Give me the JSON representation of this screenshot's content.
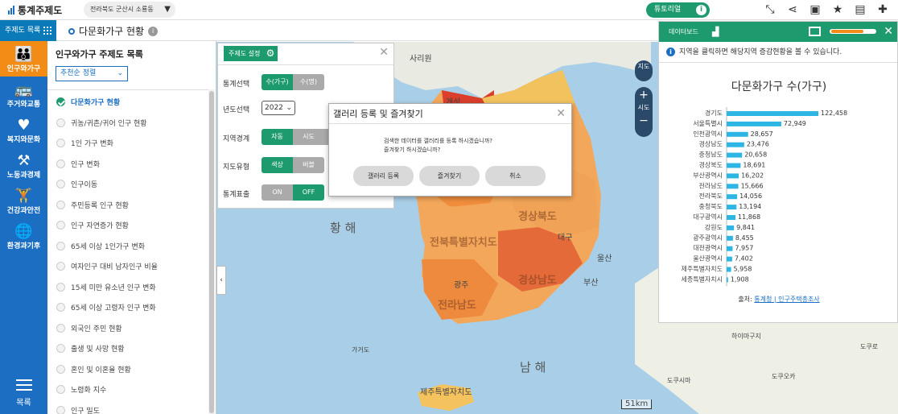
{
  "header": {
    "brand": "통계주제도",
    "region": "전라북도 군산시 소룡동",
    "tutorial": "튜토리얼"
  },
  "subbar": {
    "menu_toggle": "주제도 목록",
    "page_title": "다문화가구 현황"
  },
  "nav": {
    "items": [
      {
        "label": "인구와가구",
        "icon": "family-icon"
      },
      {
        "label": "주거와교통",
        "icon": "bus-icon"
      },
      {
        "label": "복지와문화",
        "icon": "heart-icon"
      },
      {
        "label": "노동과경제",
        "icon": "worker-icon"
      },
      {
        "label": "건강과안전",
        "icon": "exercise-icon"
      },
      {
        "label": "환경과기후",
        "icon": "globe-icon"
      }
    ],
    "bottom_label": "목록"
  },
  "theme_panel": {
    "title": "인구와가구 주제도 목록",
    "sort": "추천순 정렬",
    "items": [
      "다문화가구 현황",
      "귀농/귀촌/귀어 인구 현황",
      "1인 가구 변화",
      "인구 변화",
      "인구이동",
      "주민등록 인구 현황",
      "인구 자연증가 현황",
      "65세 이상 1인가구 변화",
      "여자인구 대비 남자인구 비율",
      "15세 미만 유소년 인구 변화",
      "65세 이상 고령자 인구 변화",
      "외국인 주민 현황",
      "출생 및 사망 현황",
      "혼인 및 이혼율 현황",
      "노령화 지수",
      "인구 밀도"
    ]
  },
  "settings": {
    "button": "주제도 설정",
    "rows": [
      {
        "label": "통계선택",
        "options": [
          "수(가구)",
          "수(명)"
        ],
        "active": 0
      },
      {
        "label": "년도선택",
        "year": "2022"
      },
      {
        "label": "지역경계",
        "options": [
          "자동",
          "시도",
          ""
        ],
        "active": 0
      },
      {
        "label": "지도유형",
        "options": [
          "색상",
          "버블"
        ],
        "active": 0
      },
      {
        "label": "통계표출",
        "options": [
          "ON",
          "OFF"
        ],
        "active": 1
      }
    ]
  },
  "modal": {
    "title": "갤러리 등록 및 즐겨찾기",
    "line1": "검색한 데이터를 갤러리를 등록 하시겠습니까?",
    "line2": "즐겨찾기 하시겠습니까?",
    "buttons": [
      "갤러리 등록",
      "즐겨찾기",
      "취소"
    ]
  },
  "map": {
    "labels": {
      "yellow_sea": "황 해",
      "south_sea": "남 해",
      "sariwon": "사리원",
      "kaesong": "개성",
      "ulsan": "울산",
      "busan": "부산",
      "gageodo": "가거도",
      "jeonbuk": "전북특별자치도",
      "jeonnam": "전라남도",
      "gyeongbuk": "경상북도",
      "gyeongnam": "경상남도",
      "daegu": "대구",
      "jeju": "제주특별자치도",
      "kyushu_a": "하이마구지",
      "kyushu_b": "도쿠시마",
      "kyushu_c": "도쿠오카",
      "kyushu_d": "도쿠로",
      "gwangju": "광주"
    },
    "scale": "51km",
    "ctrl_map": "지도",
    "ctrl_sido": "시도"
  },
  "dashboard": {
    "title": "데이터보드",
    "notice": "지역을 클릭하면 해당지역 증감현황을 볼 수 있습니다.",
    "source_prefix": "출처:",
    "source_link": "통계청 | 인구주택총조사"
  },
  "chart_data": {
    "type": "bar",
    "title": "다문화가구 수(가구)",
    "orientation": "horizontal",
    "bar_color": "#2db6e3",
    "categories": [
      "경기도",
      "서울특별시",
      "인천광역시",
      "경상남도",
      "충청남도",
      "경상북도",
      "부산광역시",
      "전라남도",
      "전라북도",
      "충청북도",
      "대구광역시",
      "강원도",
      "광주광역시",
      "대전광역시",
      "울산광역시",
      "제주특별자치도",
      "세종특별자치시"
    ],
    "values": [
      122458,
      72949,
      28657,
      23476,
      20658,
      18691,
      16202,
      15666,
      14056,
      13194,
      11868,
      9841,
      8455,
      7957,
      7402,
      5958,
      1908
    ],
    "value_labels": [
      "122,458",
      "72,949",
      "28,657",
      "23,476",
      "20,658",
      "18,691",
      "16,202",
      "15,666",
      "14,056",
      "13,194",
      "11,868",
      "9,841",
      "8,455",
      "7,957",
      "7,402",
      "5,958",
      "1,908"
    ],
    "xlim": [
      0,
      122458
    ]
  }
}
